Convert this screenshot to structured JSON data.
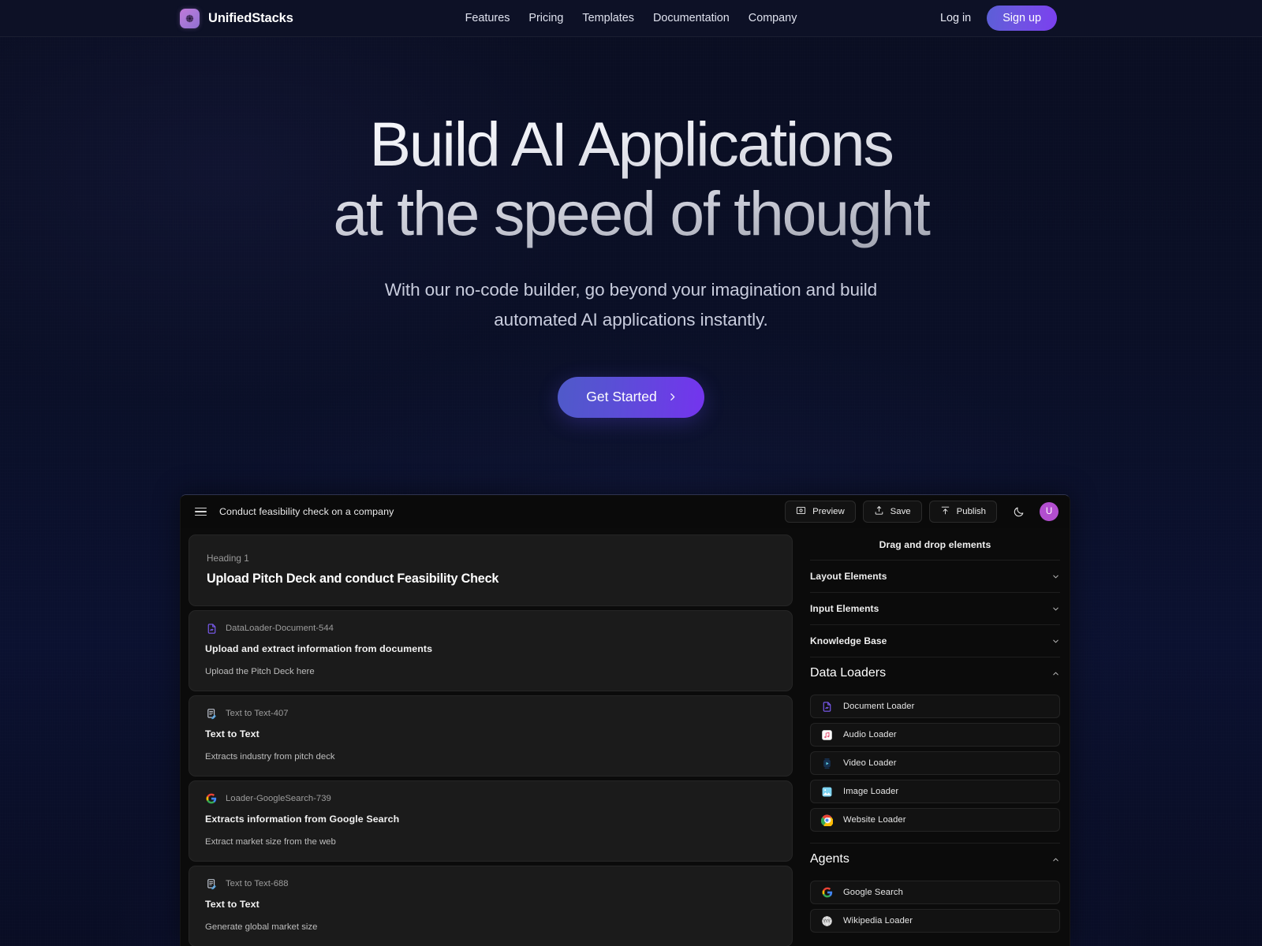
{
  "brand": {
    "name": "UnifiedStacks",
    "logo_icon": "sphere-logo-icon"
  },
  "nav": {
    "links": [
      {
        "label": "Features"
      },
      {
        "label": "Pricing"
      },
      {
        "label": "Templates"
      },
      {
        "label": "Documentation"
      },
      {
        "label": "Company"
      }
    ],
    "login_label": "Log in",
    "signup_label": "Sign up"
  },
  "hero": {
    "title_line1": "Build AI Applications",
    "title_line2": "at the speed of thought",
    "sub_line1": "With our no-code builder, go beyond your imagination and build",
    "sub_line2": "automated AI applications instantly.",
    "cta_label": "Get Started",
    "cta_icon": "chevron-right-icon"
  },
  "app": {
    "menu_icon": "hamburger-menu-icon",
    "title": "Conduct feasibility check on a company",
    "toolbar": [
      {
        "label": "Preview",
        "icon": "eye-preview-icon"
      },
      {
        "label": "Save",
        "icon": "save-disk-icon"
      },
      {
        "label": "Publish",
        "icon": "upload-publish-icon"
      }
    ],
    "theme_icon": "moon-icon",
    "avatar_initial": "U",
    "canvas": {
      "heading_card": {
        "label": "Heading 1",
        "text": "Upload Pitch Deck and conduct Feasibility Check"
      },
      "nodes": [
        {
          "id": "DataLoader-Document-544",
          "title": "Upload and extract information from documents",
          "desc": "Upload the Pitch Deck here",
          "icon": "document-purple-icon"
        },
        {
          "id": "Text to Text-407",
          "title": "Text to Text",
          "desc": "Extracts industry from pitch deck",
          "icon": "text-to-text-icon"
        },
        {
          "id": "Loader-GoogleSearch-739",
          "title": "Extracts information from Google Search",
          "desc": "Extract market size from the web",
          "icon": "google-g-icon"
        },
        {
          "id": "Text to Text-688",
          "title": "Text to Text",
          "desc": "Generate global market size",
          "icon": "text-to-text-icon"
        }
      ]
    },
    "panel": {
      "title": "Drag and drop elements",
      "sections": [
        {
          "label": "Layout Elements",
          "expanded": false,
          "chevron": "chevron-down-icon",
          "items": []
        },
        {
          "label": "Input Elements",
          "expanded": false,
          "chevron": "chevron-down-icon",
          "items": []
        },
        {
          "label": "Knowledge Base",
          "expanded": false,
          "chevron": "chevron-down-icon",
          "items": []
        },
        {
          "label": "Data Loaders",
          "expanded": true,
          "chevron": "chevron-up-icon",
          "items": [
            {
              "label": "Document Loader",
              "icon": "document-purple-icon"
            },
            {
              "label": "Audio Loader",
              "icon": "audio-note-icon"
            },
            {
              "label": "Video Loader",
              "icon": "video-play-icon"
            },
            {
              "label": "Image Loader",
              "icon": "image-photo-icon"
            },
            {
              "label": "Website Loader",
              "icon": "chrome-browser-icon"
            }
          ]
        },
        {
          "label": "Agents",
          "expanded": true,
          "chevron": "chevron-up-icon",
          "items": [
            {
              "label": "Google Search",
              "icon": "google-g-icon"
            },
            {
              "label": "Wikipedia Loader",
              "icon": "wikipedia-globe-icon"
            }
          ]
        }
      ]
    }
  },
  "colors": {
    "accent_purple": "#7434ee",
    "brand_gradient_start": "#c177d9",
    "avatar": "#b24ecf",
    "page_bg": "#0a0e22",
    "app_bg": "#0b0b0b"
  }
}
